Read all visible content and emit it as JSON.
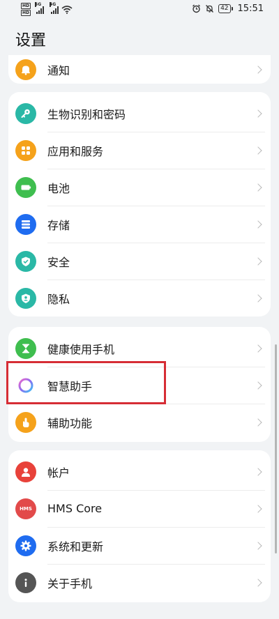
{
  "status_bar": {
    "left_tags": [
      "HD",
      "HD"
    ],
    "net_labels": [
      "5G",
      "4G"
    ],
    "battery": "42",
    "time": "15:51"
  },
  "page_title": "设置",
  "groups": [
    {
      "items": [
        {
          "label": "通知",
          "icon": "bell-icon",
          "color": "#f5a21b"
        }
      ]
    },
    {
      "items": [
        {
          "label": "生物识别和密码",
          "icon": "key-icon",
          "color": "#2ab8a6"
        },
        {
          "label": "应用和服务",
          "icon": "apps-grid-icon",
          "color": "#f5a21b"
        },
        {
          "label": "电池",
          "icon": "battery-icon",
          "color": "#3fbe4f"
        },
        {
          "label": "存储",
          "icon": "storage-icon",
          "color": "#1f6cf0"
        },
        {
          "label": "安全",
          "icon": "shield-icon",
          "color": "#2ab8a6"
        },
        {
          "label": "隐私",
          "icon": "privacy-icon",
          "color": "#2ab8a6"
        }
      ]
    },
    {
      "items": [
        {
          "label": "健康使用手机",
          "icon": "hourglass-icon",
          "color": "#3fbe4f"
        },
        {
          "label": "智慧助手",
          "icon": "assistant-ring-icon",
          "color": "#8a6cf0"
        },
        {
          "label": "辅助功能",
          "icon": "hand-icon",
          "color": "#f5a21b"
        }
      ]
    },
    {
      "items": [
        {
          "label": "帐户",
          "icon": "user-icon",
          "color": "#e8423a"
        },
        {
          "label": "HMS Core",
          "icon": "hms-icon",
          "color": "#e24a4a"
        },
        {
          "label": "系统和更新",
          "icon": "gear-icon",
          "color": "#1f6cf0"
        },
        {
          "label": "关于手机",
          "icon": "info-icon",
          "color": "#555555"
        }
      ]
    }
  ],
  "hms_icon_text": "HMS"
}
